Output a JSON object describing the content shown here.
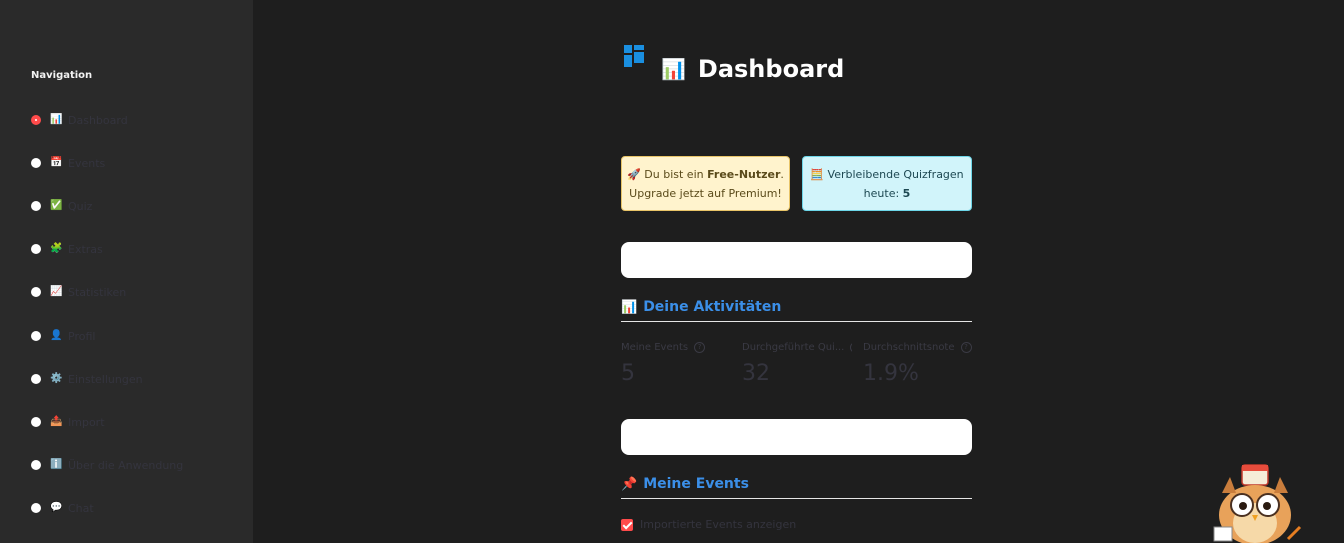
{
  "sidebar": {
    "title": "Navigation",
    "items": [
      {
        "emoji": "📊",
        "label": "Dashboard",
        "selected": true
      },
      {
        "emoji": "📅",
        "label": "Events",
        "selected": false
      },
      {
        "emoji": "✅",
        "label": "Quiz",
        "selected": false
      },
      {
        "emoji": "🧩",
        "label": "Extras",
        "selected": false
      },
      {
        "emoji": "📈",
        "label": "Statistiken",
        "selected": false
      },
      {
        "emoji": "👤",
        "label": "Profil",
        "selected": false
      },
      {
        "emoji": "⚙️",
        "label": "Einstellungen",
        "selected": false
      },
      {
        "emoji": "📤",
        "label": "Import",
        "selected": false
      },
      {
        "emoji": "ℹ️",
        "label": "Über die Anwendung",
        "selected": false
      },
      {
        "emoji": "💬",
        "label": "Chat",
        "selected": false
      }
    ]
  },
  "header": {
    "title_emoji": "📊",
    "title": "Dashboard"
  },
  "alerts": {
    "warning": {
      "emoji": "🚀",
      "prefix": "Du bist ein ",
      "bold": "Free-Nutzer",
      "suffix": ". Upgrade jetzt auf Premium!"
    },
    "info": {
      "emoji": "🧮",
      "prefix": "Verbleibende Quizfragen heute: ",
      "bold": "5"
    }
  },
  "activities": {
    "emoji": "📊",
    "heading": "Deine Aktivitäten",
    "metrics": [
      {
        "label": "Meine Events",
        "value": "5"
      },
      {
        "label": "Durchgeführte Qui...",
        "value": "32"
      },
      {
        "label": "Durchschnittsnote",
        "value": "1.9%"
      }
    ]
  },
  "events": {
    "emoji": "📌",
    "heading": "Meine Events",
    "checkbox_label": "Importierte Events anzeigen",
    "checkbox_checked": true
  },
  "colors": {
    "accent": "#ff4b4b",
    "heading_blue": "#3b8fe8",
    "background": "#1e1e1e",
    "sidebar": "#2a2a2a"
  }
}
